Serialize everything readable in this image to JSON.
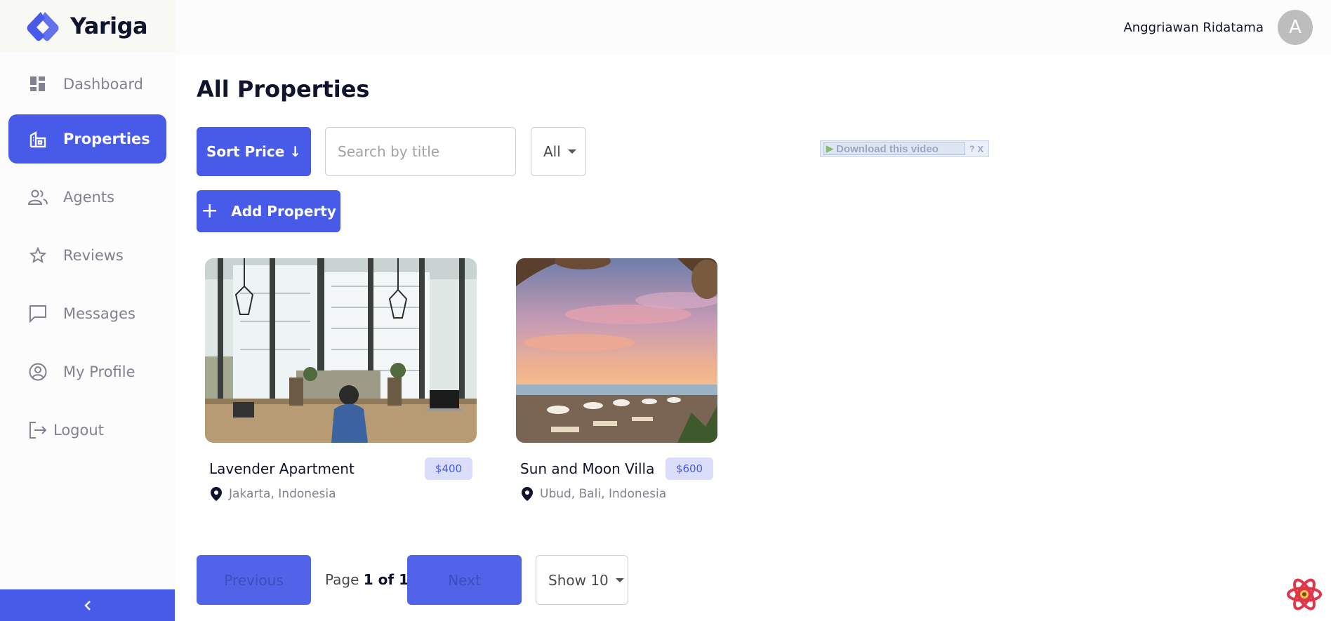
{
  "brand": {
    "name": "Yariga",
    "accent": "#475be8"
  },
  "sidebar": {
    "items": [
      {
        "label": "Dashboard",
        "icon": "dashboard-icon",
        "active": false
      },
      {
        "label": "Properties",
        "icon": "properties-icon",
        "active": true
      },
      {
        "label": "Agents",
        "icon": "agents-icon",
        "active": false
      },
      {
        "label": "Reviews",
        "icon": "star-icon",
        "active": false
      },
      {
        "label": "Messages",
        "icon": "message-icon",
        "active": false
      },
      {
        "label": "My Profile",
        "icon": "profile-icon",
        "active": false
      },
      {
        "label": "Logout",
        "icon": "logout-icon",
        "active": false
      }
    ],
    "collapse_icon": "chevron-left-icon"
  },
  "header": {
    "user_name": "Anggriawan Ridatama",
    "avatar_initial": "A"
  },
  "main": {
    "title": "All Properties",
    "sort_label": "Sort Price ↓",
    "search": {
      "placeholder": "Search by title",
      "value": ""
    },
    "type_filter": {
      "selected": "All"
    },
    "add_label": "Add Property",
    "download_overlay": {
      "label": "Download this video",
      "help": "?",
      "close": "X"
    }
  },
  "properties": [
    {
      "title": "Lavender Apartment",
      "price": "$400",
      "location": "Jakarta, Indonesia"
    },
    {
      "title": "Sun and Moon Villa",
      "price": "$600",
      "location": "Ubud, Bali, Indonesia"
    }
  ],
  "pagination": {
    "previous_label": "Previous",
    "next_label": "Next",
    "page_prefix": "Page",
    "page_value": "1 of 1",
    "page_size_label": "Show 10"
  }
}
